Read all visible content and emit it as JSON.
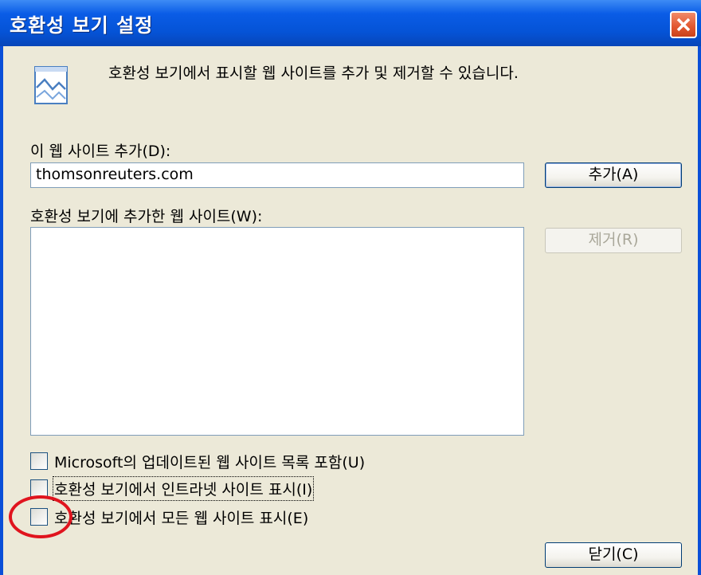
{
  "window": {
    "title": "호환성 보기 설정"
  },
  "description": "호환성 보기에서 표시할 웹 사이트를 추가 및 제거할 수 있습니다.",
  "add_site": {
    "label": "이 웹 사이트 추가(D):",
    "value": "thomsonreuters.com",
    "add_button": "추가(A)"
  },
  "sites_list": {
    "label": "호환성 보기에 추가한 웹 사이트(W):",
    "items": [],
    "remove_button": "제거(R)"
  },
  "options": [
    {
      "label": "Microsoft의 업데이트된 웹 사이트 목록 포함(U)",
      "checked": false
    },
    {
      "label": "호환성 보기에서 인트라넷 사이트 표시(I)",
      "checked": false
    },
    {
      "label": "호환성 보기에서 모든 웹 사이트 표시(E)",
      "checked": false
    }
  ],
  "close_button": "닫기(C)",
  "colors": {
    "titlebar": "#0553d6",
    "dialog_bg": "#ece9d8",
    "highlight_circle": "#e0141e"
  },
  "icons": {
    "header": "web-page-image-icon",
    "close": "close-icon"
  }
}
